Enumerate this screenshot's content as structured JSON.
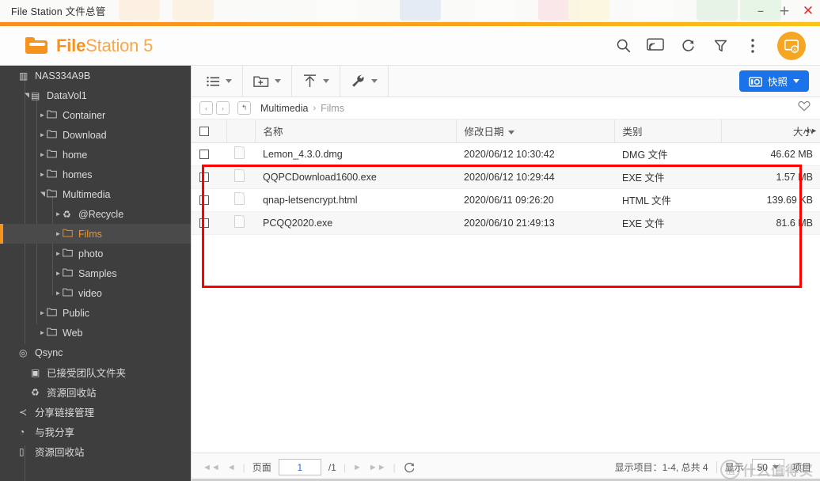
{
  "window": {
    "title": "File Station 文件总管",
    "minimize_label": "–",
    "maximize_label": "+",
    "close_label": "✕"
  },
  "header": {
    "brand_bold": "File",
    "brand_rest": "Station 5",
    "icons": [
      {
        "name": "search-icon",
        "label": "搜索"
      },
      {
        "name": "cast-icon",
        "label": "串流"
      },
      {
        "name": "refresh-icon",
        "label": "刷新"
      },
      {
        "name": "filter-icon",
        "label": "筛选"
      },
      {
        "name": "more-vertical-icon",
        "label": "更多"
      }
    ],
    "avatar_name": "remote-access-icon"
  },
  "sidebar": {
    "items": [
      {
        "label": "NAS334A9B",
        "icon": "nas-icon",
        "indent": 0,
        "twisty": "",
        "selected": false
      },
      {
        "label": "DataVol1",
        "icon": "volume-icon",
        "indent": 1,
        "twisty": "open",
        "selected": false
      },
      {
        "label": "Container",
        "icon": "folder-icon",
        "indent": 2,
        "twisty": "closed",
        "selected": false
      },
      {
        "label": "Download",
        "icon": "folder-icon",
        "indent": 2,
        "twisty": "closed",
        "selected": false
      },
      {
        "label": "home",
        "icon": "folder-icon",
        "indent": 2,
        "twisty": "closed",
        "selected": false
      },
      {
        "label": "homes",
        "icon": "folder-icon",
        "indent": 2,
        "twisty": "closed",
        "selected": false
      },
      {
        "label": "Multimedia",
        "icon": "folder-icon",
        "indent": 2,
        "twisty": "open",
        "selected": false
      },
      {
        "label": "@Recycle",
        "icon": "recycle-icon",
        "indent": 3,
        "twisty": "closed",
        "selected": false
      },
      {
        "label": "Films",
        "icon": "folder-icon",
        "indent": 3,
        "twisty": "closed",
        "selected": true
      },
      {
        "label": "photo",
        "icon": "folder-icon",
        "indent": 3,
        "twisty": "closed",
        "selected": false
      },
      {
        "label": "Samples",
        "icon": "folder-icon",
        "indent": 3,
        "twisty": "closed",
        "selected": false
      },
      {
        "label": "video",
        "icon": "folder-icon",
        "indent": 3,
        "twisty": "closed",
        "selected": false
      },
      {
        "label": "Public",
        "icon": "folder-icon",
        "indent": 2,
        "twisty": "closed",
        "selected": false
      },
      {
        "label": "Web",
        "icon": "folder-icon",
        "indent": 2,
        "twisty": "closed",
        "selected": false
      },
      {
        "label": "Qsync",
        "icon": "qsync-icon",
        "indent": 0,
        "twisty": "",
        "selected": false
      },
      {
        "label": "已接受团队文件夹",
        "icon": "team-folder-icon",
        "indent": 1,
        "twisty": "",
        "selected": false
      },
      {
        "label": "资源回收站",
        "icon": "recycle-icon",
        "indent": 1,
        "twisty": "",
        "selected": false
      },
      {
        "label": "分享链接管理",
        "icon": "share-icon",
        "indent": 0,
        "twisty": "",
        "selected": false
      },
      {
        "label": "与我分享",
        "icon": "shared-with-me-icon",
        "indent": 0,
        "twisty": "",
        "selected": false
      },
      {
        "label": "资源回收站",
        "icon": "trash-icon",
        "indent": 0,
        "twisty": "",
        "selected": false
      }
    ]
  },
  "toolbar": {
    "buttons": [
      {
        "name": "view-mode-button",
        "icon": "list-view-icon"
      },
      {
        "name": "create-folder-button",
        "icon": "folder-plus-icon"
      },
      {
        "name": "upload-button",
        "icon": "upload-arrow-icon"
      },
      {
        "name": "tools-button",
        "icon": "wrench-icon"
      }
    ],
    "snapshot_label": "快照"
  },
  "breadcrumb": {
    "back_label": "‹",
    "forward_label": "›",
    "up_label": "↰",
    "separator": "›",
    "path": [
      {
        "label": "Multimedia",
        "current": false
      },
      {
        "label": "Films",
        "current": true
      }
    ]
  },
  "table": {
    "columns": [
      {
        "key": "check",
        "label": ""
      },
      {
        "key": "icon",
        "label": ""
      },
      {
        "key": "name",
        "label": "名称"
      },
      {
        "key": "date",
        "label": "修改日期",
        "sorted": true
      },
      {
        "key": "type",
        "label": "类别"
      },
      {
        "key": "size",
        "label": "大小"
      }
    ],
    "rows": [
      {
        "name": "Lemon_4.3.0.dmg",
        "date": "2020/06/12 10:30:42",
        "type": "DMG 文件",
        "size": "46.62 MB"
      },
      {
        "name": "QQPCDownload1600.exe",
        "date": "2020/06/12 10:29:44",
        "type": "EXE 文件",
        "size": "1.57 MB"
      },
      {
        "name": "qnap-letsencrypt.html",
        "date": "2020/06/11 09:26:20",
        "type": "HTML 文件",
        "size": "139.69 KB"
      },
      {
        "name": "PCQQ2020.exe",
        "date": "2020/06/10 21:49:13",
        "type": "EXE 文件",
        "size": "81.6 MB"
      }
    ]
  },
  "statusbar": {
    "page_label": "页面",
    "page_value": "1",
    "page_total": "/1",
    "showing_text": "显示项目：1-4, 总共 4",
    "per_page_label": "显示",
    "per_page_value": "50",
    "per_page_suffix": "项目"
  },
  "watermark": {
    "circle_glyph": "值",
    "text": "什么值得买"
  },
  "colors": {
    "accent_orange": "#f6921e",
    "sidebar_bg": "#3e3e3e",
    "selected_text": "#f7941d",
    "snapshot_blue": "#1a73e8",
    "annotation_red": "#ff0000"
  }
}
